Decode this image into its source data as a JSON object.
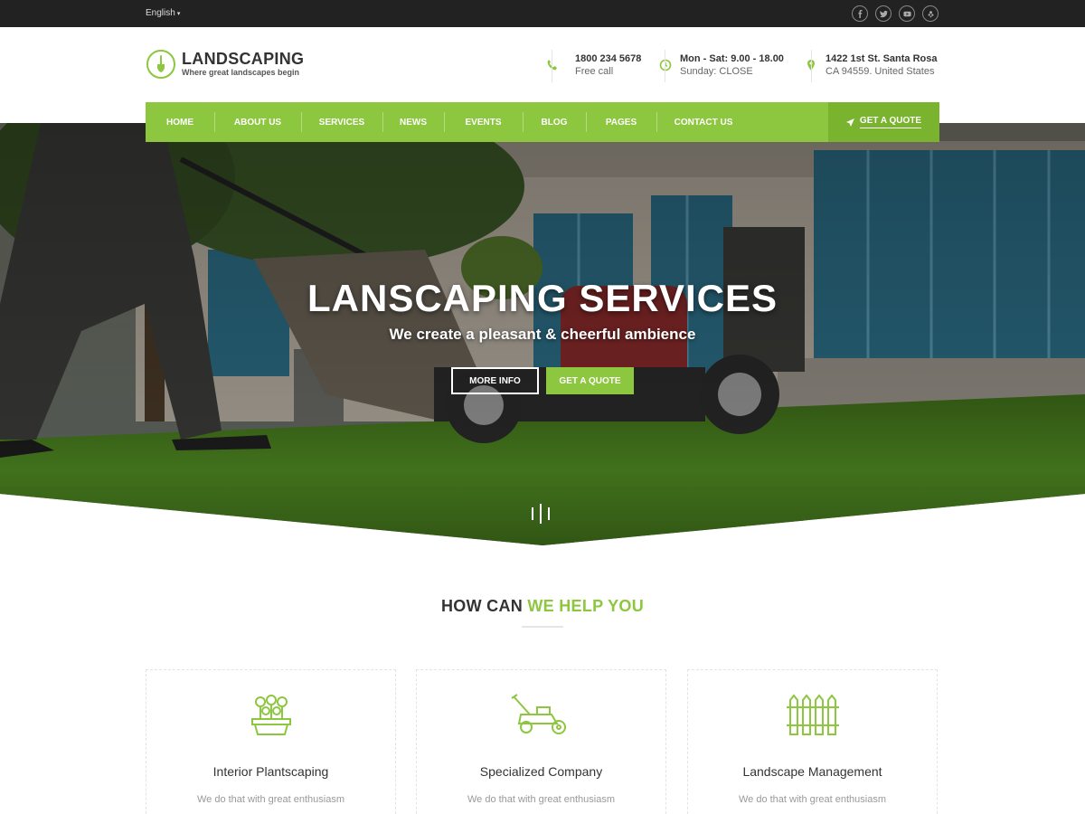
{
  "topbar": {
    "language": "English",
    "socials": [
      "facebook-icon",
      "twitter-icon",
      "youtube-icon",
      "yelp-icon"
    ]
  },
  "header": {
    "brand": "LANDSCAPING",
    "tagline": "Where great landscapes begin",
    "phone": {
      "line1": "1800 234 5678",
      "line2": "Free call"
    },
    "hours": {
      "line1": "Mon - Sat: 9.00 - 18.00",
      "line2": "Sunday: CLOSE"
    },
    "address": {
      "line1": "1422 1st St. Santa Rosa",
      "line2": "CA 94559. United States"
    }
  },
  "nav": {
    "items": [
      "HOME",
      "ABOUT US",
      "SERVICES",
      "NEWS",
      "EVENTS",
      "BLOG",
      "PAGES",
      "CONTACT US"
    ],
    "quote": "GET A QUOTE"
  },
  "hero": {
    "title": "LANSCAPING SERVICES",
    "subtitle": "We create a pleasant & cheerful ambience",
    "more_info": "MORE INFO",
    "get_quote": "GET A QUOTE",
    "slides": 3
  },
  "section": {
    "title_main": "HOW CAN ",
    "title_accent": "WE HELP YOU"
  },
  "cards": [
    {
      "icon": "flower-pot-icon",
      "title": "Interior Plantscaping",
      "text": "We do that with great enthusiasm"
    },
    {
      "icon": "lawn-mower-icon",
      "title": "Specialized Company",
      "text": "We do that with great enthusiasm"
    },
    {
      "icon": "fence-icon",
      "title": "Landscape Management",
      "text": "We do that with great enthusiasm"
    }
  ],
  "colors": {
    "accent": "#8dc63f",
    "topbar": "#222222",
    "text": "#333333"
  }
}
